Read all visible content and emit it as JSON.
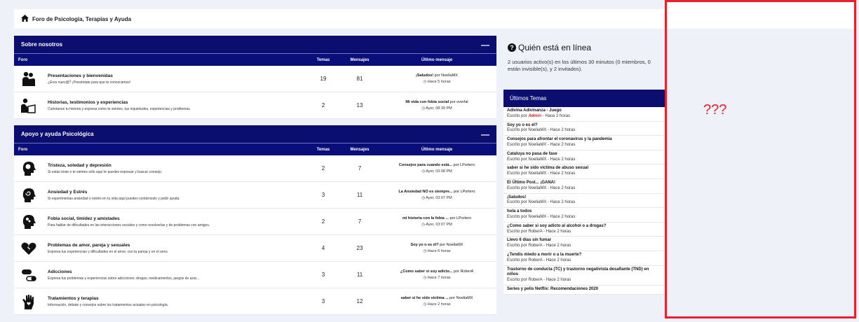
{
  "breadcrumb": {
    "title": "Foro de Psicología, Terapias y Ayuda"
  },
  "columns": {
    "forum": "Foro",
    "topics": "Temas",
    "messages": "Mensajes",
    "last": "Último mensaje"
  },
  "categories": [
    {
      "title": "Sobre nosotros",
      "collapse": "—",
      "forums": [
        {
          "icon": "group-hug-icon",
          "title": "Presentaciones y bienvenidas",
          "desc": "¿Eres nuev@? ¡Preséntate para que te conozcamos!",
          "topics": "19",
          "messages": "81",
          "last_title": "¡Saludos!",
          "last_by": " por NoeliaMX",
          "last_time": "Hace 5 horas"
        },
        {
          "icon": "person-reading-icon",
          "title": "Historias, testimonios y experiencias",
          "desc": "Cuéntanos tu historia y expresa como te sientes, tus inquietudes, experiencias y problemas.",
          "topics": "2",
          "messages": "13",
          "last_title": "Mi vida con fobia social",
          "last_by": " por overfal",
          "last_time": "Ayer, 08:39 PM"
        }
      ]
    },
    {
      "title": "Apoyo y ayuda Psicológica",
      "collapse": "—",
      "forums": [
        {
          "icon": "head-brain-icon",
          "title": "Tristeza, soledad y depresión",
          "desc": "Si estás triste o te sientes sólo aquí te puedes expresar y buscar consejo.",
          "topics": "2",
          "messages": "7",
          "last_title": "Consejos para cuando está...",
          "last_by": " por LPortero",
          "last_time": "Ayer, 03:08 PM"
        },
        {
          "icon": "head-spiral-icon",
          "title": "Ansiedad y Estrés",
          "desc": "Si experimentas ansiedad o estrés en tu vida aquí puedes contárnoslo y pedir ayuda.",
          "topics": "3",
          "messages": "11",
          "last_title": "La Ansiedad NO es siempre...",
          "last_by": " por LPortero",
          "last_time": "Ayer, 03:07 PM"
        },
        {
          "icon": "head-gears-icon",
          "title": "Fobia social, timidez y amistades",
          "desc": "Para hablar de dificultades en las interacciones sociales y como resolverlas y de problemas con amigos.",
          "topics": "2",
          "messages": "7",
          "last_title": "mi historia con la fobia ...",
          "last_by": " por LPortero",
          "last_time": "Ayer, 03:07 PM"
        },
        {
          "icon": "broken-heart-icon",
          "title": "Problemas de amor, pareja y sexuales",
          "desc": "Expresa tus experiencias y dificultades en el amor, con tu pareja y en el sexo.",
          "topics": "4",
          "messages": "23",
          "last_title": "Soy yo o es él?",
          "last_by": " por NoeliaMX",
          "last_time": "Hace 6 horas"
        },
        {
          "icon": "pills-icon",
          "title": "Adicciones",
          "desc": "Expresa tus problemas y experiencias sobre adicciones: drogas, medicamentos, juegos de azar...",
          "topics": "3",
          "messages": "11",
          "last_title": "¿Como saber si soy adicto...",
          "last_by": " por RoberA",
          "last_time": "Hace 7 horas"
        },
        {
          "icon": "hand-heart-icon",
          "title": "Tratamientos y terapias",
          "desc": "Información, debate y consejos sobre los tratamientos actuales en psicología.",
          "topics": "3",
          "messages": "12",
          "last_title": "saber si he sido victima ...",
          "last_by": " por NoeliaMX",
          "last_time": "Hace 2 horas"
        }
      ]
    }
  ],
  "online": {
    "title": "Quién está en línea",
    "text": "2 usuarios activo(s) en los últimos 30 minutos (0 miembros, 0 están invisible(s), y 2 invitados)."
  },
  "latest": {
    "title": "Últimos Temas",
    "topics": [
      {
        "title": "Adivina Adivinanza - Juego",
        "prefix": "Escrito por ",
        "author": "Admin",
        "suffix": " - Hace 2 horas"
      },
      {
        "title": "Soy yo o es él?",
        "meta": "Escrito por NoeliaMX - Hace 2 horas"
      },
      {
        "title": "Consejos para afrontar el coronavirus y la pandemia",
        "meta": "Escrito por NoeliaMX - Hace 2 horas"
      },
      {
        "title": "Cataluya no pasa de fase",
        "meta": "Escrito por NoeliaMX - Hace 2 horas"
      },
      {
        "title": "saber si he sido victima de abuso sexual",
        "meta": "Escrito por NoeliaMX - Hace 2 horas"
      },
      {
        "title": "El Último Post... ¡GANA!",
        "meta": "Escrito por NoeliaMX - Hace 2 horas"
      },
      {
        "title": "¡Saludos!",
        "meta": "Escrito por NoeliaMX - Hace 2 horas"
      },
      {
        "title": "hola a todos",
        "meta": "Escrito por NoeliaMX - Hace 2 horas"
      },
      {
        "title": "¿Como saber si soy adicto al alcohol o a drogas?",
        "meta": "Escrito por RoberA - Hace 2 horas"
      },
      {
        "title": "Llevo 6 días sin fumar",
        "meta": "Escrito por RoberA - Hace 2 horas"
      },
      {
        "title": "¿Tendis miedo a morir o a la muerte?",
        "meta": "Escrito por RoberA - Hace 2 horas"
      },
      {
        "title": "Trastorno de conducta (TC) y trastorno negativista desafiante (TND) en niños",
        "meta": "Escrito por RoberA - Hace 2 horas"
      },
      {
        "title": "Series y pelis Netflix: Recomendaciones 2020",
        "meta": ""
      }
    ]
  },
  "placeholder": {
    "text": "???"
  }
}
